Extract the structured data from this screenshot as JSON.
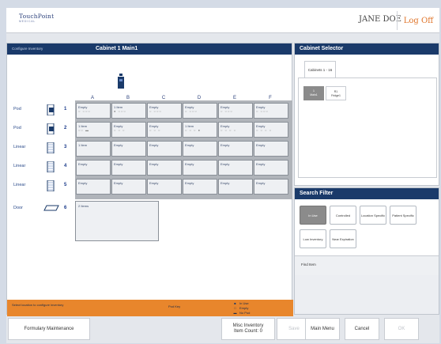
{
  "header": {
    "logo_name": "TouchPoint",
    "logo_sub": "MEDICAL",
    "user_name": "JANE DOE",
    "logoff_label": "Log Off"
  },
  "configure": {
    "subtitle": "Configure Inventory",
    "title": "Cabinet 1 Main1",
    "column_labels": [
      "A",
      "B",
      "C",
      "D",
      "E",
      "F"
    ],
    "rows": [
      {
        "type": "Pod",
        "number": "1",
        "cells": [
          {
            "text": "Empty",
            "dots": "○ ○○○"
          },
          {
            "text": "1 Item",
            "dots": "● ○○○"
          },
          {
            "text": "Empty",
            "dots": "○ ○○○"
          },
          {
            "text": "Empty",
            "dots": "○ ○○○"
          },
          {
            "text": "Empty",
            "dots": "○ ○○○"
          },
          {
            "text": "Empty",
            "dots": "○ ○○○"
          }
        ]
      },
      {
        "type": "Pod",
        "number": "2",
        "cells": [
          {
            "text": "1 Item",
            "dots": "○○ ▬"
          },
          {
            "text": "Empty",
            "dots": "○ ○ ○"
          },
          {
            "text": "Empty",
            "dots": "○ ○ ○"
          },
          {
            "text": "1 Item",
            "dots": "○ ○ ○ ●"
          },
          {
            "text": "Empty",
            "dots": "○ ○ ○ ○"
          },
          {
            "text": "Empty",
            "dots": "○ ○ ○ ○"
          }
        ]
      },
      {
        "type": "Linear",
        "number": "3",
        "cells": [
          {
            "text": "1 Item",
            "dots": ""
          },
          {
            "text": "Empty",
            "dots": ""
          },
          {
            "text": "Empty",
            "dots": ""
          },
          {
            "text": "Empty",
            "dots": ""
          },
          {
            "text": "Empty",
            "dots": ""
          },
          {
            "text": "Empty",
            "dots": ""
          }
        ]
      },
      {
        "type": "Linear",
        "number": "4",
        "cells": [
          {
            "text": "Empty",
            "dots": ""
          },
          {
            "text": "Empty",
            "dots": ""
          },
          {
            "text": "Empty",
            "dots": ""
          },
          {
            "text": "Empty",
            "dots": ""
          },
          {
            "text": "Empty",
            "dots": ""
          },
          {
            "text": "Empty",
            "dots": ""
          }
        ]
      },
      {
        "type": "Linear",
        "number": "5",
        "cells": [
          {
            "text": "Empty",
            "dots": ""
          },
          {
            "text": "Empty",
            "dots": ""
          },
          {
            "text": "Empty",
            "dots": ""
          },
          {
            "text": "Empty",
            "dots": ""
          },
          {
            "text": "Empty",
            "dots": ""
          },
          {
            "text": "Empty",
            "dots": ""
          }
        ]
      }
    ],
    "door": {
      "type": "Door",
      "number": "6",
      "text": "2 Items"
    },
    "footer_message": "Select location to configure inventory",
    "key_label": "Pod Key",
    "key_items": [
      {
        "symbol": "■",
        "label": "In Use"
      },
      {
        "symbol": "□",
        "label": "Empty"
      },
      {
        "symbol": "▬",
        "label": "No Pod"
      }
    ]
  },
  "cabinet_selector": {
    "title": "Cabinet Selector",
    "tab_label": "Cabinets 1 - 16",
    "cabinets": [
      {
        "label_top": "1",
        "label_bottom": "Main1",
        "selected": true
      },
      {
        "label_top": "R1",
        "label_bottom": "Fridge1",
        "selected": false
      }
    ]
  },
  "search_filter": {
    "title": "Search Filter",
    "buttons": [
      {
        "label": "In Use",
        "active": true
      },
      {
        "label": "Controlled",
        "active": false
      },
      {
        "label": "Location Specific",
        "active": false
      },
      {
        "label": "Patient Specific",
        "active": false
      },
      {
        "label": "Low Inventory",
        "active": false
      },
      {
        "label": "Near Expiration",
        "active": false
      }
    ],
    "find_item_label": "Find Item"
  },
  "bottom_bar": {
    "formulary_label": "Formulary Maintenance",
    "misc_line1": "Misc Inventory",
    "misc_line2": "Item Count: 0",
    "save_label": "Save",
    "main_menu_label": "Main Menu",
    "cancel_label": "Cancel",
    "ok_label": "OK"
  },
  "colors": {
    "header_navy": "#1a3a6a",
    "accent_orange": "#e8862c",
    "logoff_orange": "#e0762c"
  }
}
